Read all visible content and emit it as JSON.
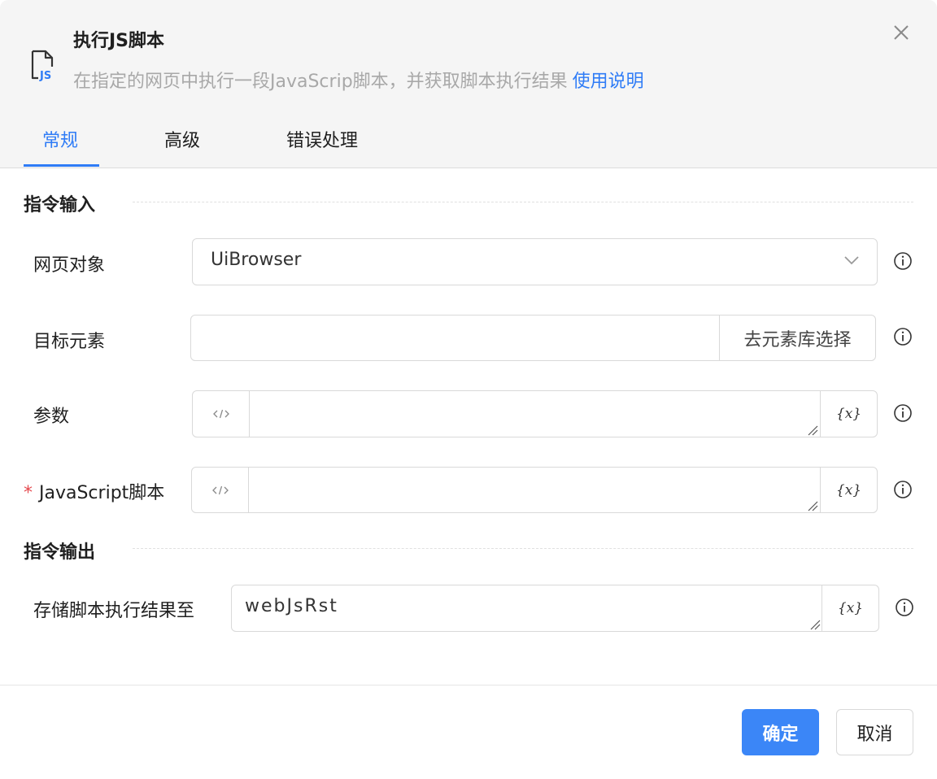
{
  "dialog": {
    "title": "执行JS脚本",
    "description": "在指定的网页中执行一段JavaScrip脚本，并获取脚本执行结果",
    "help_link": "使用说明",
    "icon_label": "JS"
  },
  "tabs": [
    {
      "label": "常规",
      "active": true
    },
    {
      "label": "高级",
      "active": false
    },
    {
      "label": "错误处理",
      "active": false
    }
  ],
  "sections": {
    "input_title": "指令输入",
    "output_title": "指令输出"
  },
  "fields": {
    "web_object": {
      "label": "网页对象",
      "value": "UiBrowser"
    },
    "target_element": {
      "label": "目标元素",
      "value": "",
      "button": "去元素库选择"
    },
    "params": {
      "label": "参数",
      "value": "",
      "var_button": "{x}"
    },
    "js_script": {
      "label": "JavaScript脚本",
      "required_mark": "*",
      "value": "",
      "var_button": "{x}"
    },
    "store_result": {
      "label": "存储脚本执行结果至",
      "value": "webJsRst",
      "var_button": "{x}"
    }
  },
  "footer": {
    "confirm": "确定",
    "cancel": "取消"
  },
  "colors": {
    "accent": "#2f7cf6",
    "primary_button": "#3b86f7",
    "required": "#e5484d",
    "header_bg": "#f5f5f5"
  },
  "icons": {
    "file": "js-file-icon",
    "close": "close-icon",
    "dropdown": "chevron-down-icon",
    "code": "code-icon",
    "info": "info-icon",
    "resize": "resize-grip-icon"
  }
}
